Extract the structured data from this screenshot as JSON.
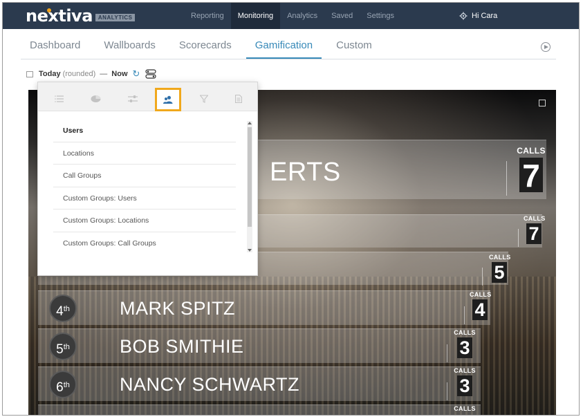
{
  "app": {
    "logo_text": "nextiva",
    "logo_badge": "ANALYTICS"
  },
  "topnav": {
    "items": [
      {
        "label": "Reporting"
      },
      {
        "label": "Monitoring"
      },
      {
        "label": "Analytics"
      },
      {
        "label": "Saved"
      },
      {
        "label": "Settings"
      }
    ],
    "active": "Monitoring",
    "user_greeting": "Hi Cara"
  },
  "subtabs": {
    "items": [
      {
        "label": "Dashboard"
      },
      {
        "label": "Wallboards"
      },
      {
        "label": "Scorecards"
      },
      {
        "label": "Gamification"
      },
      {
        "label": "Custom"
      }
    ],
    "active": "Gamification"
  },
  "datebar": {
    "start": "Today",
    "qualifier": "(rounded)",
    "separator": "—",
    "end": "Now"
  },
  "panel": {
    "tab_icons": [
      "list-icon",
      "pie-chart-icon",
      "sliders-icon",
      "users-icon",
      "filter-icon",
      "document-icon"
    ],
    "active_tab": "users-icon",
    "items": [
      {
        "label": "Users"
      },
      {
        "label": "Locations"
      },
      {
        "label": "Call Groups"
      },
      {
        "label": "Custom Groups: Users"
      },
      {
        "label": "Custom Groups: Locations"
      },
      {
        "label": "Custom Groups: Call Groups"
      }
    ],
    "active_item": "Users"
  },
  "leaderboard": {
    "calls_label": "CALLS",
    "rows": [
      {
        "rank": "",
        "rank_suffix": "",
        "name": "ERTS",
        "calls": "7"
      },
      {
        "rank": "",
        "rank_suffix": "",
        "name": "",
        "calls": "7"
      },
      {
        "rank": "",
        "rank_suffix": "",
        "name": "",
        "calls": "5"
      },
      {
        "rank": "4",
        "rank_suffix": "th",
        "name": "MARK SPITZ",
        "calls": "4"
      },
      {
        "rank": "5",
        "rank_suffix": "th",
        "name": "BOB SMITHIE",
        "calls": "3"
      },
      {
        "rank": "6",
        "rank_suffix": "th",
        "name": "NANCY SCHWARTZ",
        "calls": "3"
      },
      {
        "rank": "",
        "rank_suffix": "",
        "name": "",
        "calls": ""
      }
    ]
  },
  "colors": {
    "navbar": "#2b3a4e",
    "accent": "#3789b8",
    "active_tab_border": "#f0a81c"
  }
}
